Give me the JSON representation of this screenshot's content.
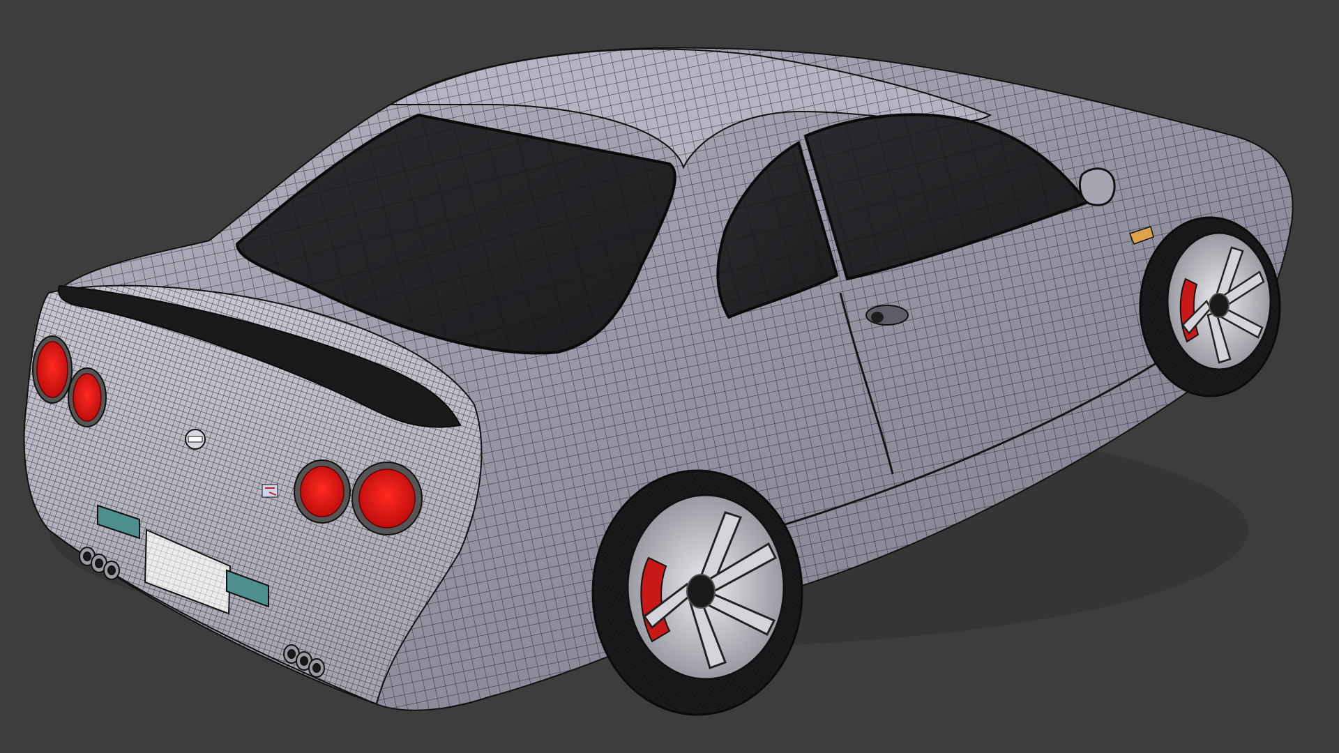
{
  "viewport": {
    "background": "#3d3d3d",
    "display_mode": "wireframe-on-shaded"
  },
  "model": {
    "subject": "sports-coupe",
    "body_color": "#9a98a6",
    "glass_color": "#262427",
    "wire_color": "#1b1b22",
    "taillight_color": "#e81010",
    "brake_caliper_color": "#c81818",
    "plate_color": "#ececec",
    "reflector_color": "#4d8f8d",
    "indicator_color": "#e0a24a",
    "wheel_count_visible": 2,
    "taillight_count": 4
  }
}
